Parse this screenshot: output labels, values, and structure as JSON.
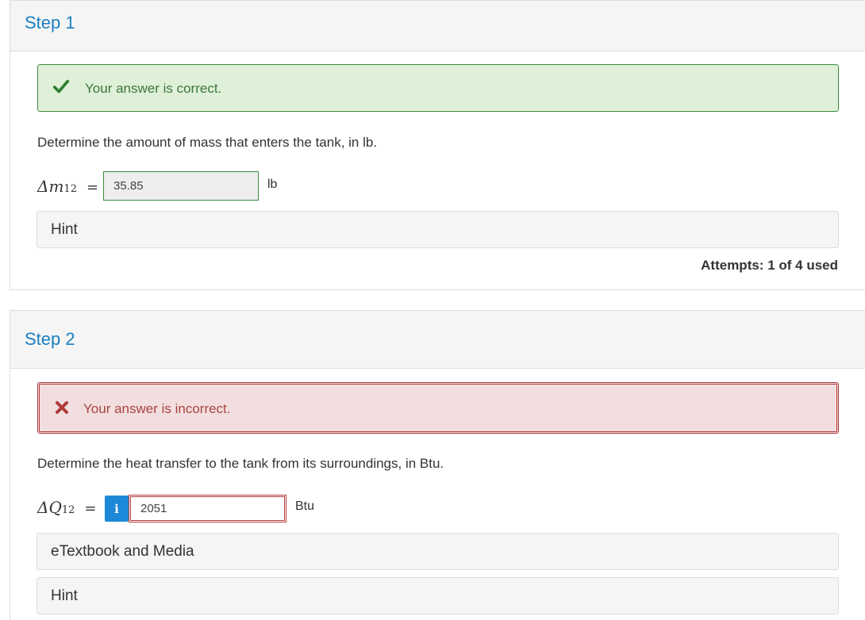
{
  "step1": {
    "title": "Step 1",
    "feedback": "Your answer is correct.",
    "question": "Determine the amount of mass that enters the tank, in lb.",
    "variable": {
      "symbol": "Δm",
      "subscript": "12",
      "equals": "="
    },
    "answer": "35.85",
    "unit": "lb",
    "hint_label": "Hint",
    "attempts": "Attempts: 1 of 4 used"
  },
  "step2": {
    "title": "Step 2",
    "feedback": "Your answer is incorrect.",
    "question": "Determine the heat transfer to the tank from its surroundings, in Btu.",
    "variable": {
      "symbol": "ΔQ",
      "subscript": "12",
      "equals": "="
    },
    "info_button": "i",
    "answer": "2051",
    "unit": "Btu",
    "etextbook_label": "eTextbook and Media",
    "hint_label": "Hint"
  },
  "colors": {
    "link_blue": "#1a7fc1",
    "success_bg": "#dff0d8",
    "success_border": "#3c8b3c",
    "danger_bg": "#f2dede",
    "danger_border": "#b03a3a",
    "info_blue": "#1e88d8"
  },
  "icons": {
    "correct": "check-icon",
    "incorrect": "x-icon",
    "info": "info-icon"
  }
}
